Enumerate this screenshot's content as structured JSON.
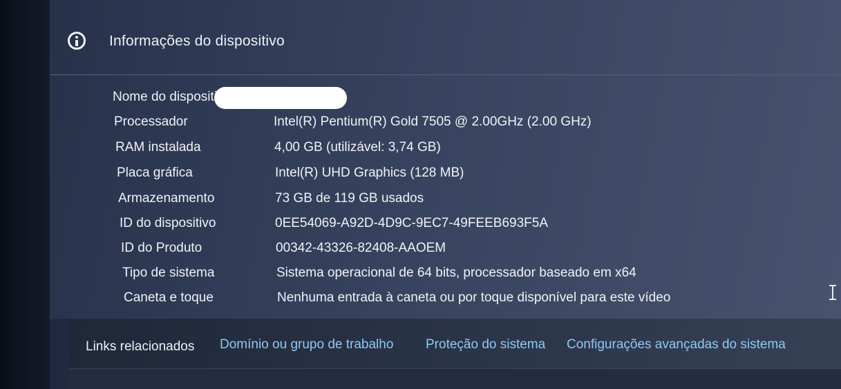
{
  "section": {
    "icon": "info-icon",
    "title": "Informações do dispositivo"
  },
  "specs": [
    {
      "label": "Nome do dispositivo",
      "value": ""
    },
    {
      "label": "Processador",
      "value": "Intel(R) Pentium(R) Gold 7505 @ 2.00GHz (2.00 GHz)"
    },
    {
      "label": "RAM instalada",
      "value": "4,00 GB (utilizável: 3,74 GB)"
    },
    {
      "label": "Placa gráfica",
      "value": "Intel(R) UHD Graphics (128 MB)"
    },
    {
      "label": "Armazenamento",
      "value": "73 GB de 119 GB usados"
    },
    {
      "label": "ID do dispositivo",
      "value": "0EE54069-A92D-4D9C-9EC7-49FEEB693F5A"
    },
    {
      "label": "ID do Produto",
      "value": "00342-43326-82408-AAOEM"
    },
    {
      "label": "Tipo de sistema",
      "value": "Sistema operacional de 64 bits, processador baseado em x64"
    },
    {
      "label": "Caneta e toque",
      "value": "Nenhuma entrada à caneta ou por toque disponível para este vídeo"
    }
  ],
  "related": {
    "label": "Links relacionados",
    "links": [
      "Domínio ou grupo de trabalho",
      "Proteção do sistema",
      "Configurações avançadas do sistema"
    ]
  },
  "colors": {
    "link": "#8ec9f4",
    "text": "#f0f2f7",
    "panel": "#37435e"
  }
}
